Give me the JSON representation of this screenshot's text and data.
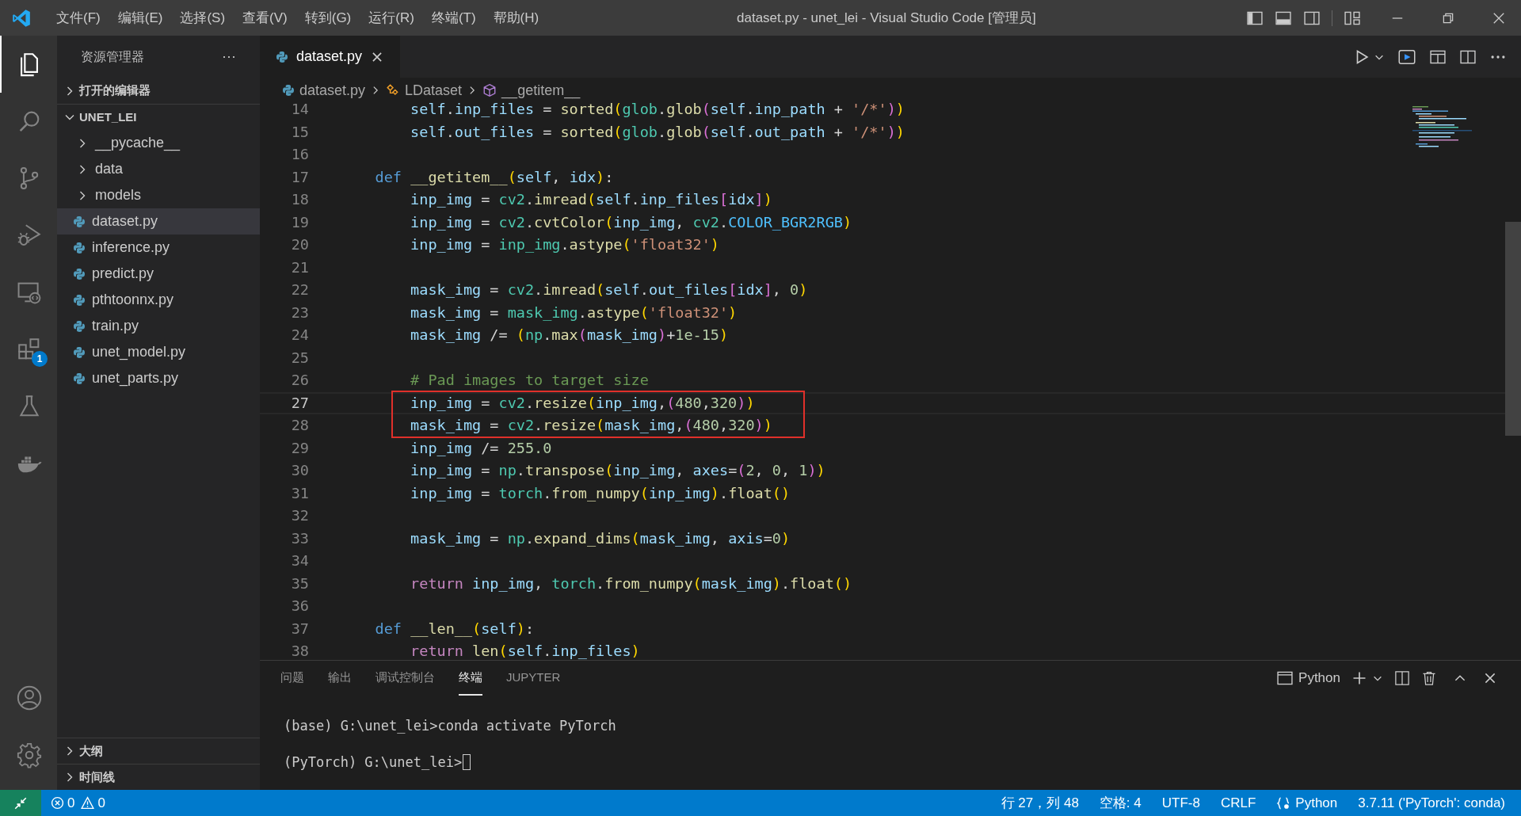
{
  "window": {
    "title": "dataset.py - unet_lei - Visual Studio Code [管理员]"
  },
  "menu": [
    "文件(F)",
    "编辑(E)",
    "选择(S)",
    "查看(V)",
    "转到(G)",
    "运行(R)",
    "终端(T)",
    "帮助(H)"
  ],
  "activity_bar": {
    "top": [
      {
        "kind": "explorer",
        "selected": true
      },
      {
        "kind": "search",
        "selected": false
      },
      {
        "kind": "source-control",
        "selected": false
      },
      {
        "kind": "run-debug",
        "selected": false
      },
      {
        "kind": "remote",
        "selected": false
      },
      {
        "kind": "extensions",
        "selected": false,
        "badge": "1"
      },
      {
        "kind": "testing",
        "selected": false
      },
      {
        "kind": "docker",
        "selected": false
      }
    ],
    "bottom": [
      {
        "kind": "account",
        "selected": false
      },
      {
        "kind": "settings",
        "selected": false
      }
    ]
  },
  "sidebar": {
    "title": "资源管理器",
    "more": "···",
    "sections": [
      {
        "title": "打开的编辑器",
        "expanded": false
      },
      {
        "title": "UNET_LEI",
        "expanded": true,
        "items": [
          {
            "label": "__pycache__",
            "kind": "folder",
            "selected": false
          },
          {
            "label": "data",
            "kind": "folder",
            "selected": false
          },
          {
            "label": "models",
            "kind": "folder",
            "selected": false
          },
          {
            "label": "dataset.py",
            "kind": "python",
            "selected": true
          },
          {
            "label": "inference.py",
            "kind": "python",
            "selected": false
          },
          {
            "label": "predict.py",
            "kind": "python",
            "selected": false
          },
          {
            "label": "pthtoonnx.py",
            "kind": "python",
            "selected": false
          },
          {
            "label": "train.py",
            "kind": "python",
            "selected": false
          },
          {
            "label": "unet_model.py",
            "kind": "python",
            "selected": false
          },
          {
            "label": "unet_parts.py",
            "kind": "python",
            "selected": false
          }
        ]
      }
    ],
    "bottom_sections": [
      {
        "title": "大纲",
        "expanded": false
      },
      {
        "title": "时间线",
        "expanded": false
      }
    ]
  },
  "editor": {
    "tabs": [
      {
        "label": "dataset.py",
        "selected": true
      }
    ],
    "breadcrumb": [
      {
        "label": "dataset.py",
        "kind": "file"
      },
      {
        "label": "LDataset",
        "kind": "class"
      },
      {
        "label": "__getitem__",
        "kind": "method"
      }
    ],
    "lines": [
      {
        "number": "14",
        "current": false,
        "boxed": false,
        "text": "        self.inp_files = sorted(glob.glob(self.inp_path + '/*'))"
      },
      {
        "number": "15",
        "current": false,
        "boxed": false,
        "text": "        self.out_files = sorted(glob.glob(self.out_path + '/*'))"
      },
      {
        "number": "16",
        "current": false,
        "boxed": false
      },
      {
        "number": "17",
        "current": false,
        "boxed": false,
        "text": "    def __getitem__(self, idx):"
      },
      {
        "number": "18",
        "current": false,
        "boxed": false,
        "text": "        inp_img = cv2.imread(self.inp_files[idx])"
      },
      {
        "number": "19",
        "current": false,
        "boxed": false,
        "text": "        inp_img = cv2.cvtColor(inp_img, cv2.COLOR_BGR2RGB)"
      },
      {
        "number": "20",
        "current": false,
        "boxed": false,
        "text": "        inp_img = inp_img.astype('float32')"
      },
      {
        "number": "21",
        "current": false,
        "boxed": false
      },
      {
        "number": "22",
        "current": false,
        "boxed": false,
        "text": "        mask_img = cv2.imread(self.out_files[idx], 0)"
      },
      {
        "number": "23",
        "current": false,
        "boxed": false,
        "text": "        mask_img = mask_img.astype('float32')"
      },
      {
        "number": "24",
        "current": false,
        "boxed": false,
        "text": "        mask_img /= (np.max(mask_img)+1e-15)"
      },
      {
        "number": "25",
        "current": false,
        "boxed": false
      },
      {
        "number": "26",
        "current": false,
        "boxed": false,
        "text": "        # Pad images to target size"
      },
      {
        "number": "27",
        "current": true,
        "boxed": true,
        "text": "        inp_img = cv2.resize(inp_img,(480,320))"
      },
      {
        "number": "28",
        "current": false,
        "boxed": true,
        "text": "        mask_img = cv2.resize(mask_img,(480,320))"
      },
      {
        "number": "29",
        "current": false,
        "boxed": false,
        "text": "        inp_img /= 255.0"
      },
      {
        "number": "30",
        "current": false,
        "boxed": false,
        "text": "        inp_img = np.transpose(inp_img, axes=(2, 0, 1))"
      },
      {
        "number": "31",
        "current": false,
        "boxed": false,
        "text": "        inp_img = torch.from_numpy(inp_img).float()"
      },
      {
        "number": "32",
        "current": false,
        "boxed": false
      },
      {
        "number": "33",
        "current": false,
        "boxed": false,
        "text": "        mask_img = np.expand_dims(mask_img, axis=0)"
      },
      {
        "number": "34",
        "current": false,
        "boxed": false
      },
      {
        "number": "35",
        "current": false,
        "boxed": false,
        "text": "        return inp_img, torch.from_numpy(mask_img).float()"
      },
      {
        "number": "36",
        "current": false,
        "boxed": false
      },
      {
        "number": "37",
        "current": false,
        "boxed": false,
        "text": "    def __len__(self):"
      },
      {
        "number": "38",
        "current": false,
        "boxed": false,
        "text": "        return len(self.inp_files)"
      }
    ]
  },
  "panel": {
    "tabs": [
      {
        "label": "问题",
        "selected": false
      },
      {
        "label": "输出",
        "selected": false
      },
      {
        "label": "调试控制台",
        "selected": false
      },
      {
        "label": "终端",
        "selected": true
      },
      {
        "label": "JUPYTER",
        "selected": false
      }
    ],
    "terminal_name": "Python",
    "terminal_lines": [
      "(base) G:\\unet_lei>conda activate PyTorch",
      "(PyTorch) G:\\unet_lei>"
    ]
  },
  "status_bar": {
    "errors": "0",
    "warnings": "0",
    "position": "行 27，列 48",
    "indent": "空格: 4",
    "encoding": "UTF-8",
    "eol": "CRLF",
    "language": "Python",
    "interpreter": "3.7.11 ('PyTorch': conda)"
  }
}
